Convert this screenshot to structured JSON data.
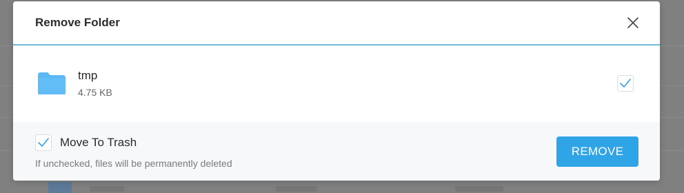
{
  "dialog": {
    "title": "Remove Folder",
    "close_icon": "close-icon"
  },
  "item": {
    "name": "tmp",
    "size": "4.75 KB",
    "icon": "folder-icon",
    "selected": true
  },
  "footer": {
    "move_to_trash_label": "Move To Trash",
    "move_to_trash_checked": true,
    "hint": "If unchecked, files will be permanently deleted",
    "remove_label": "REMOVE"
  },
  "colors": {
    "accent": "#2fa4e7",
    "folder": "#5bb8f5",
    "header_rule": "#6fb9d7",
    "overlay": "#808080"
  }
}
